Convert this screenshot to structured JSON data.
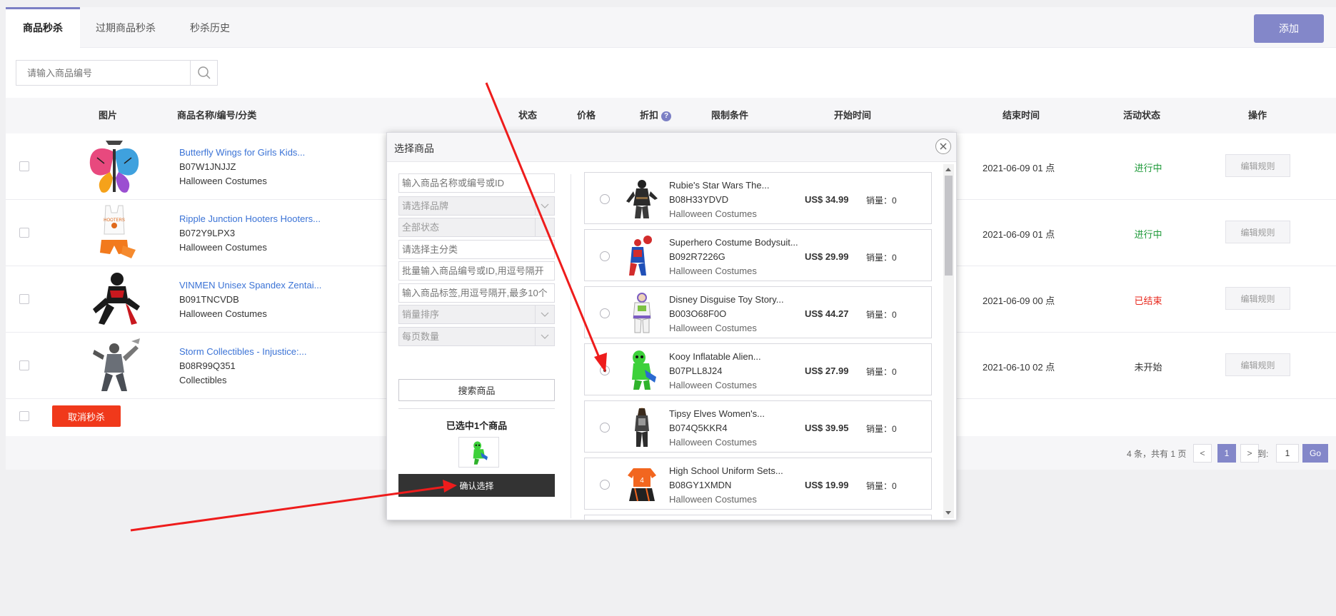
{
  "tabs": [
    {
      "label": "商品秒杀",
      "active": true
    },
    {
      "label": "过期商品秒杀",
      "active": false
    },
    {
      "label": "秒杀历史",
      "active": false
    }
  ],
  "add_button": "添加",
  "search": {
    "placeholder": "请输入商品编号"
  },
  "table": {
    "headers": {
      "image": "图片",
      "name": "商品名称/编号/分类",
      "status": "状态",
      "price": "价格",
      "discount": "折扣",
      "limit": "限制条件",
      "start": "开始时间",
      "end": "结束时间",
      "activity": "活动状态",
      "ops": "操作"
    },
    "rows": [
      {
        "name": "Butterfly Wings for Girls Kids...",
        "code": "B07W1JNJJZ",
        "category": "Halloween Costumes",
        "end_time": "2021-06-09 01 点",
        "activity_status": "进行中",
        "status_color": "#1f9a3a",
        "edit": "编辑规则"
      },
      {
        "name": "Ripple Junction Hooters Hooters...",
        "code": "B072Y9LPX3",
        "category": "Halloween Costumes",
        "end_time": "2021-06-09 01 点",
        "activity_status": "进行中",
        "status_color": "#1f9a3a",
        "edit": "编辑规则"
      },
      {
        "name": "VINMEN Unisex Spandex Zentai...",
        "code": "B091TNCVDB",
        "category": "Halloween Costumes",
        "end_time": "2021-06-09 00 点",
        "activity_status": "已结束",
        "status_color": "#e8261b",
        "edit": "编辑规则"
      },
      {
        "name": "Storm Collectibles - Injustice:...",
        "code": "B08R99Q351",
        "category": "Collectibles",
        "end_time": "2021-06-10 02 点",
        "activity_status": "未开始",
        "status_color": "#333333",
        "edit": "编辑规则"
      }
    ]
  },
  "cancel_button": "取消秒杀",
  "pager": {
    "info": "4 条，共有 1 页",
    "prev": "<",
    "current": "1",
    "next": ">",
    "to_label": "到:",
    "goto_value": "1",
    "go": "Go"
  },
  "modal": {
    "title": "选择商品",
    "filters": {
      "name_placeholder": "输入商品名称或编号或ID",
      "brand": "请选择品牌",
      "status": "全部状态",
      "category_placeholder": "请选择主分类",
      "batch_placeholder": "批量输入商品编号或ID,用逗号隔开",
      "tags_placeholder": "输入商品标签,用逗号隔开,最多10个",
      "sort": "销量排序",
      "per_page": "每页数量"
    },
    "search_button": "搜索商品",
    "selected_text": "已选中1个商品",
    "confirm_button": "确认选择",
    "products": [
      {
        "name": "Rubie's Star Wars The...",
        "code": "B08H33YDVD",
        "category": "Halloween Costumes",
        "price": "US$ 34.99",
        "sales": "销量：0",
        "selected": false
      },
      {
        "name": "Superhero Costume Bodysuit...",
        "code": "B092R7226G",
        "category": "Halloween Costumes",
        "price": "US$ 29.99",
        "sales": "销量：0",
        "selected": false
      },
      {
        "name": "Disney Disguise Toy Story...",
        "code": "B003O68F0O",
        "category": "Halloween Costumes",
        "price": "US$ 44.27",
        "sales": "销量：0",
        "selected": false
      },
      {
        "name": "Kooy Inflatable Alien...",
        "code": "B07PLL8J24",
        "category": "Halloween Costumes",
        "price": "US$ 27.99",
        "sales": "销量：0",
        "selected": true
      },
      {
        "name": "Tipsy Elves Women's...",
        "code": "B074Q5KKR4",
        "category": "Halloween Costumes",
        "price": "US$ 39.95",
        "sales": "销量：0",
        "selected": false
      },
      {
        "name": "High School Uniform Sets...",
        "code": "B08GY1XMDN",
        "category": "Halloween Costumes",
        "price": "US$ 19.99",
        "sales": "销量：0",
        "selected": false
      }
    ]
  },
  "colors": {
    "accent": "#8387c9",
    "link": "#3b73d6",
    "danger": "#f0391b",
    "annotation": "#ee1c1c"
  }
}
